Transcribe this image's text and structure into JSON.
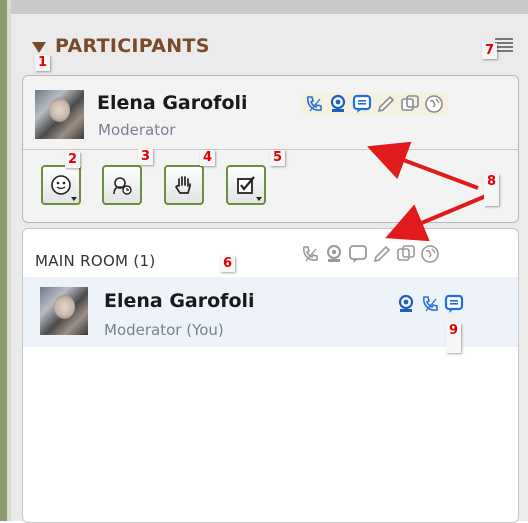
{
  "panel": {
    "title": "PARTICIPANTS",
    "accent_color": "#7a4a2a",
    "button_border_color": "#6d8f3d",
    "highlight_color": "#eef3fa"
  },
  "me": {
    "name": "Elena Garofoli",
    "role": "Moderator",
    "status_icons": [
      "telephone-icon",
      "webcam-icon",
      "chat-icon",
      "pencil-icon",
      "app-share-icon",
      "web-tour-icon"
    ]
  },
  "toolbar": {
    "buttons": [
      "emoticon-status-button",
      "step-away-button",
      "raise-hand-button",
      "poll-response-button"
    ]
  },
  "room": {
    "title": "MAIN ROOM (1)",
    "header_icons": [
      "telephone-icon",
      "webcam-icon",
      "chat-icon",
      "pencil-icon",
      "app-share-icon",
      "web-tour-icon"
    ],
    "users": [
      {
        "name": "Elena Garofoli",
        "role": "Moderator (You)",
        "icons": [
          "webcam-icon",
          "telephone-icon",
          "chat-icon"
        ]
      }
    ]
  },
  "callouts": [
    "1",
    "2",
    "3",
    "4",
    "5",
    "6",
    "7",
    "8",
    "9"
  ]
}
